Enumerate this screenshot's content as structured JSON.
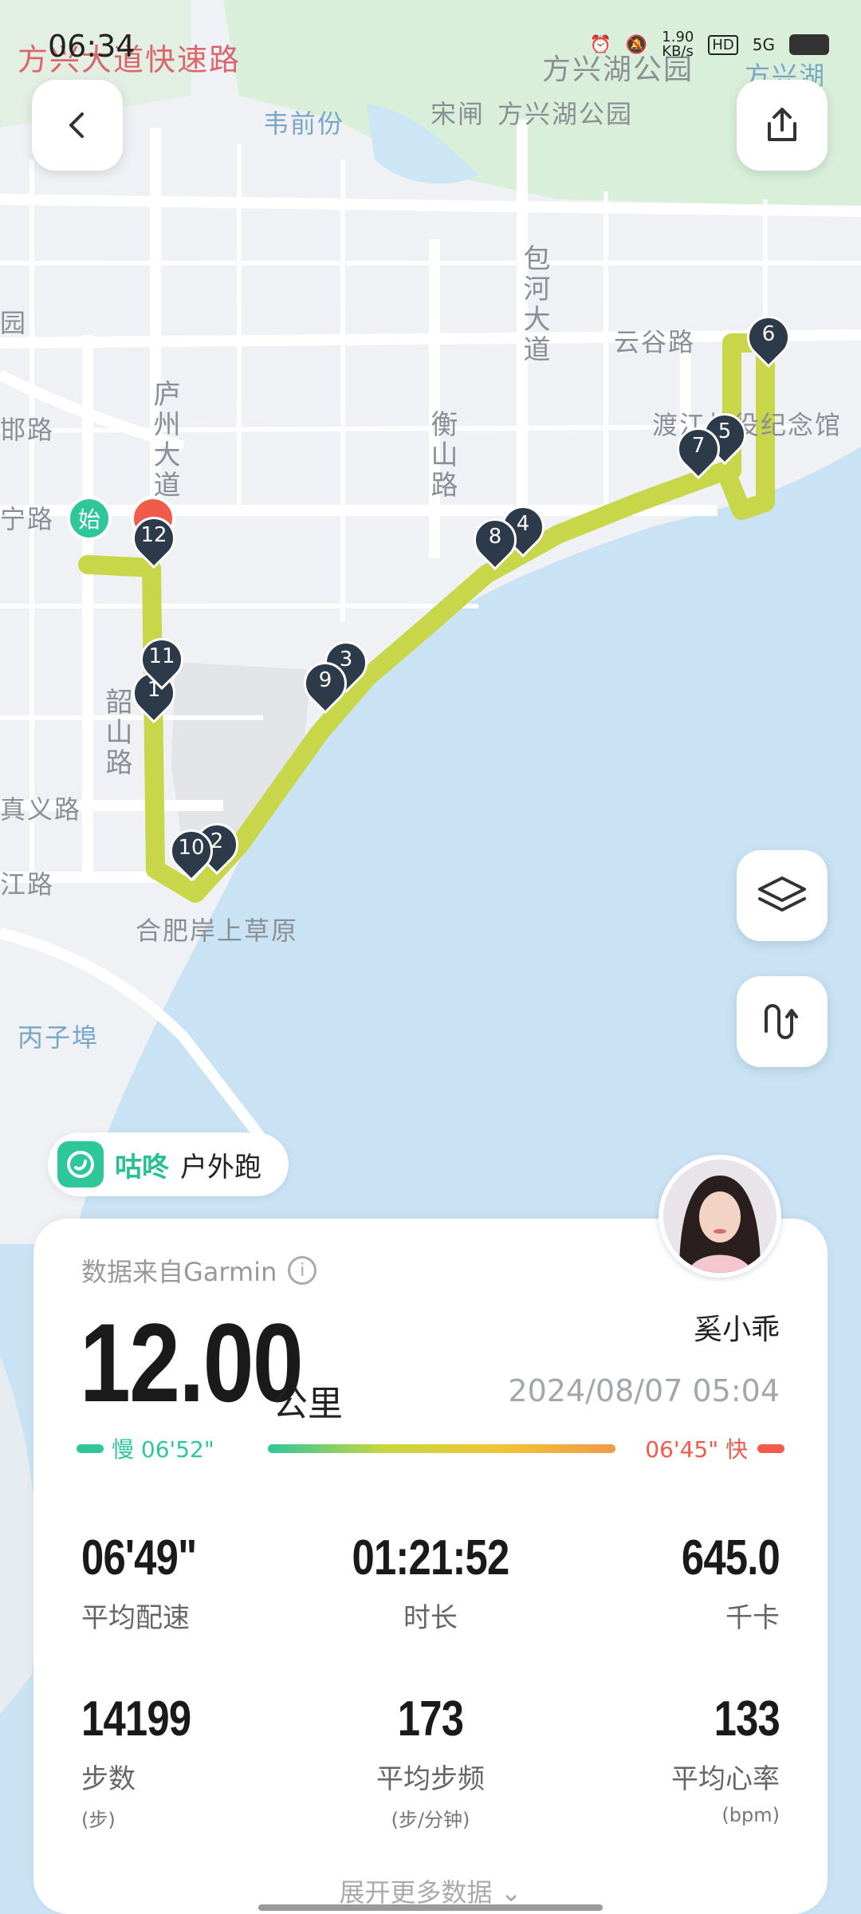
{
  "status_bar": {
    "time": "06:34",
    "net_speed": "1.90\nKB/s",
    "network": "5G",
    "hd": "HD"
  },
  "map": {
    "labels": {
      "fangxing_expressway": "方兴大道快速路",
      "fangxing_park_top": "方兴湖公园",
      "fangxing_lake": "方兴湖",
      "weiqian": "韦前份",
      "songzha": "宋闸",
      "fangxing_park": "方兴湖公园",
      "baohe": "包河大道",
      "yungu": "云谷路",
      "luzhou": "庐州大道",
      "hengshan": "衡山路",
      "dujiang": "渡江战役纪念馆",
      "shaoshan": "韶山路",
      "hefei_grassland": "合肥岸上草原",
      "bingzibu": "丙子埠",
      "lu_left1": "邯路",
      "lu_left2": "宁路",
      "lu_left3": "真义路",
      "lu_left4": "江路",
      "yuan": "园"
    },
    "start_label": "始",
    "markers": [
      "1",
      "2",
      "3",
      "4",
      "5",
      "6",
      "7",
      "8",
      "9",
      "10",
      "11",
      "12"
    ]
  },
  "brand": {
    "name": "咕咚",
    "activity": "户外跑"
  },
  "summary": {
    "source": "数据来自Garmin",
    "info_glyph": "i",
    "distance": "12.00",
    "distance_unit": "公里",
    "user_name": "奚小乖",
    "datetime": "2024/08/07 05:04",
    "pace_slow": "慢 06'52\"",
    "pace_fast": "06'45\" 快"
  },
  "stats": {
    "avg_pace": {
      "value": "06'49\"",
      "label": "平均配速"
    },
    "duration": {
      "value": "01:21:52",
      "label": "时长"
    },
    "calories": {
      "value": "645.0",
      "label": "千卡"
    },
    "steps": {
      "value": "14199",
      "label": "步数",
      "sub": "(步)"
    },
    "cadence": {
      "value": "173",
      "label": "平均步频",
      "sub": "(步/分钟)"
    },
    "heart_rate": {
      "value": "133",
      "label": "平均心率",
      "sub": "(bpm)"
    }
  },
  "expand_label": "展开更多数据",
  "colors": {
    "accent": "#2ec79a",
    "route": "#c8d64a",
    "fast": "#f05b4a",
    "marker": "#2c3a4a",
    "water": "#c9e3f5"
  },
  "icons": [
    "back-icon",
    "share-icon",
    "layers-icon",
    "route-toggle-icon",
    "info-icon",
    "brand-logo-icon",
    "chevron-down-icon"
  ]
}
